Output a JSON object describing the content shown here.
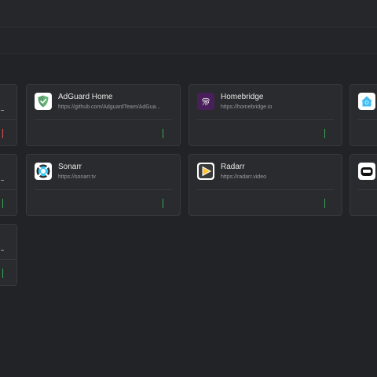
{
  "colors": {
    "status_up": "#3aa655",
    "status_down": "#d9534f",
    "adguard": "#67b279",
    "homebridge": "#491f59",
    "sonarr": "#35c5f4",
    "radarr": "#ffc230"
  },
  "cards": {
    "adguard": {
      "title": "AdGuard Home",
      "url": "https://github.com/AdguardTeam/AdGua...",
      "icon": "adguard-shield-icon"
    },
    "homebridge": {
      "title": "Homebridge",
      "url": "https://homebridge.io",
      "icon": "homebridge-fingerprint-icon"
    },
    "sonarr": {
      "title": "Sonarr",
      "url": "https://sonarr.tv",
      "icon": "sonarr-icon"
    },
    "radarr": {
      "title": "Radarr",
      "url": "https://radarr.video",
      "icon": "radarr-play-icon"
    }
  }
}
